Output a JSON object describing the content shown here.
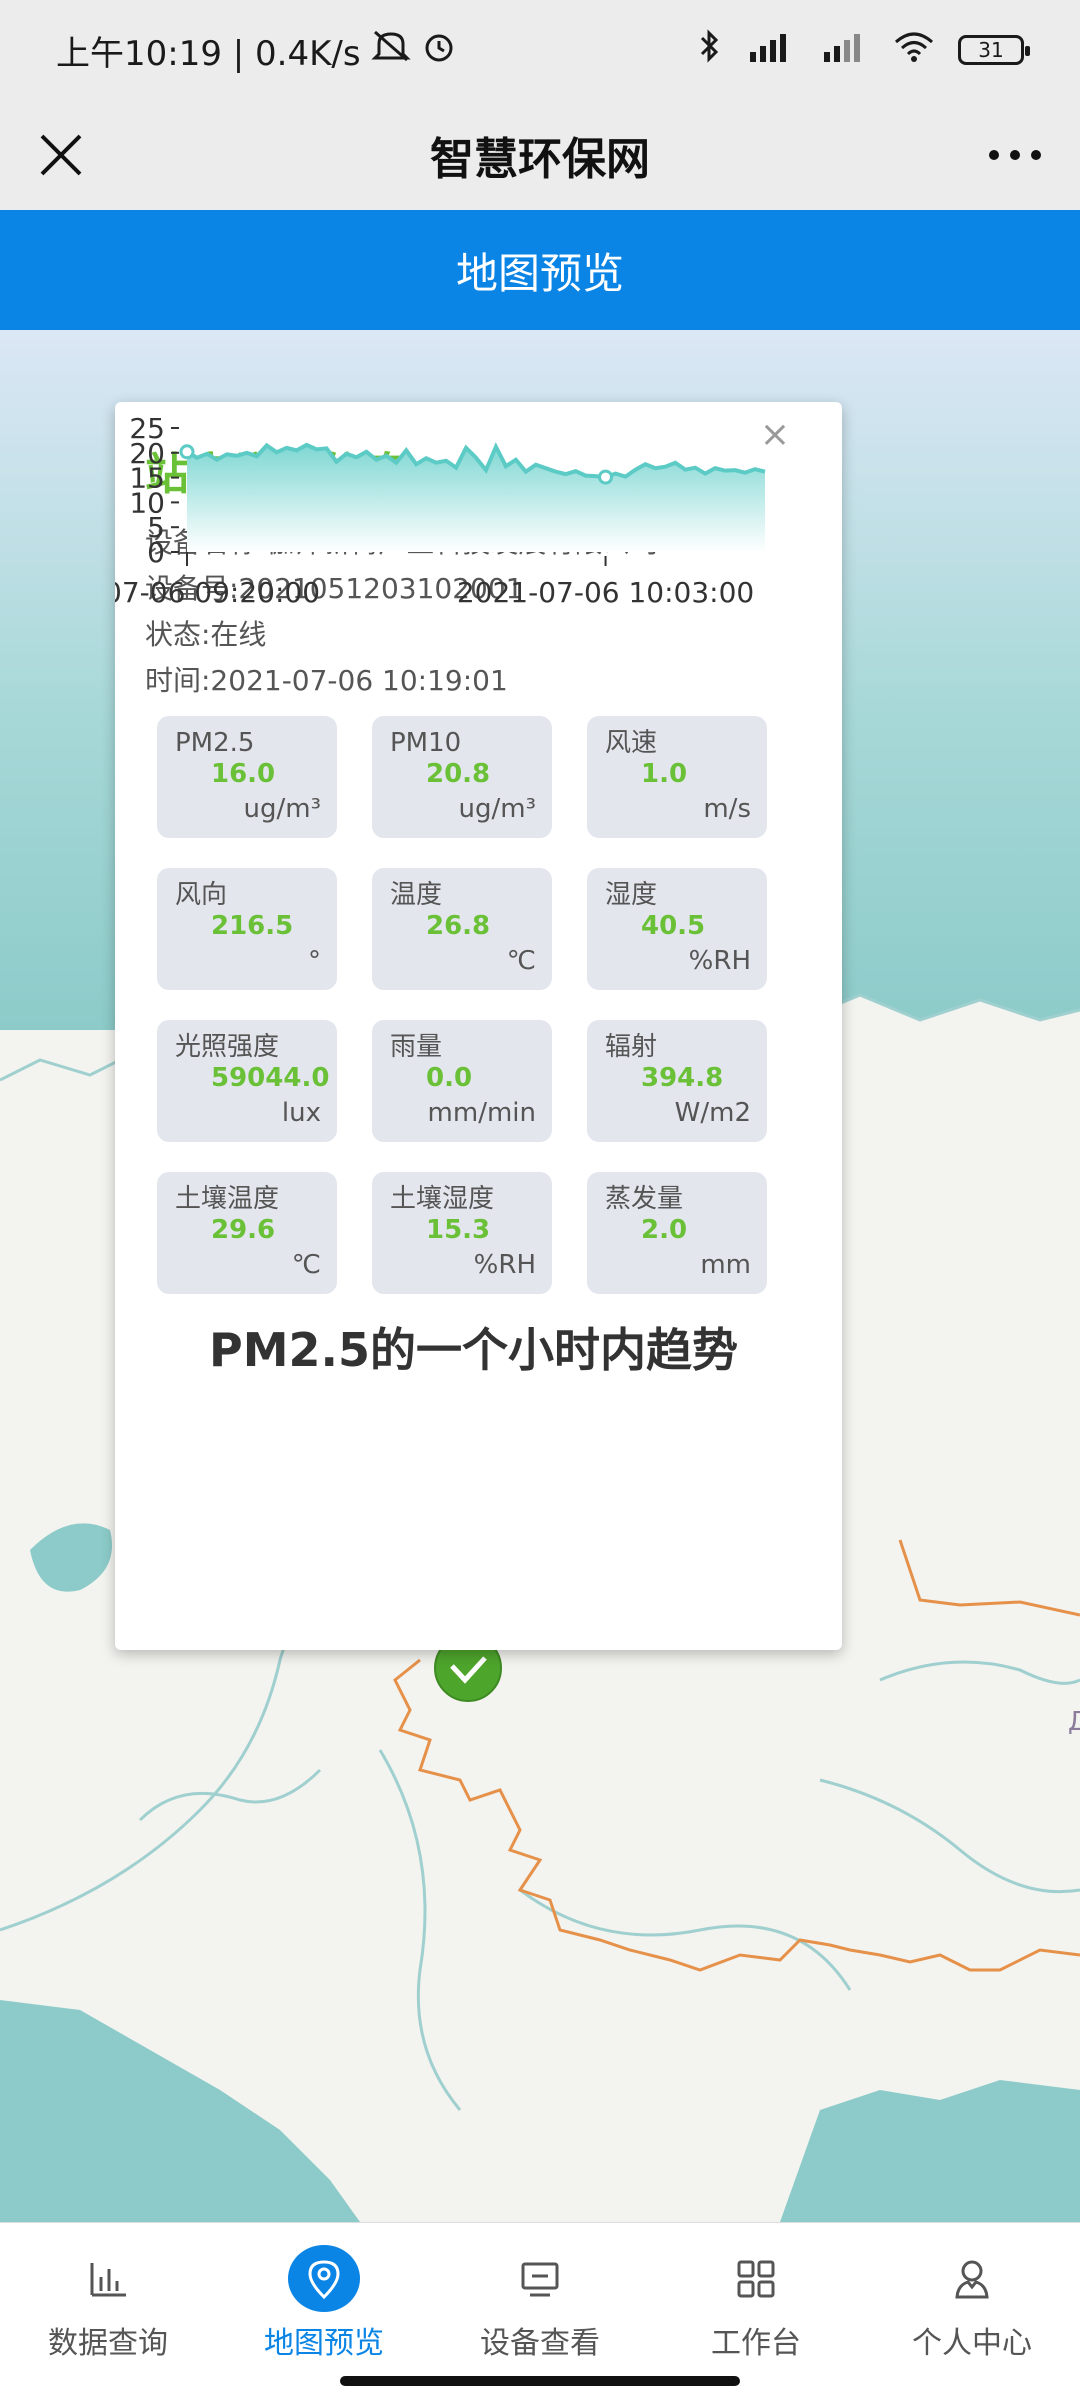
{
  "status_bar": {
    "time": "上午10:19 | 0.4K/s",
    "battery": "31"
  },
  "title_bar": {
    "title": "智慧环保网"
  },
  "header": {
    "title": "地图预览"
  },
  "popup": {
    "heading": "站点详细信息",
    "close_symbol": "×",
    "device_name": "设备名称:伽师新梅产业科技发展有限公司",
    "device_no": "设备号:2021051203102001",
    "status": "状态:在线",
    "time": "时间:2021-07-06 10:19:01",
    "metrics": [
      {
        "label": "PM2.5",
        "value": "16.0",
        "unit": "ug/m³"
      },
      {
        "label": "PM10",
        "value": "20.8",
        "unit": "ug/m³"
      },
      {
        "label": "风速",
        "value": "1.0",
        "unit": "m/s"
      },
      {
        "label": "风向",
        "value": "216.5",
        "unit": "°"
      },
      {
        "label": "温度",
        "value": "26.8",
        "unit": "℃"
      },
      {
        "label": "湿度",
        "value": "40.5",
        "unit": "%RH"
      },
      {
        "label": "光照强度",
        "value": "59044.0",
        "unit": "lux"
      },
      {
        "label": "雨量",
        "value": "0.0",
        "unit": "mm/min"
      },
      {
        "label": "辐射",
        "value": "394.8",
        "unit": "W/m2"
      },
      {
        "label": "土壤温度",
        "value": "29.6",
        "unit": "℃"
      },
      {
        "label": "土壤湿度",
        "value": "15.3",
        "unit": "%RH"
      },
      {
        "label": "蒸发量",
        "value": "2.0",
        "unit": "mm"
      }
    ],
    "chart_title": "PM2.5的一个小时内趋势"
  },
  "chart_data": {
    "type": "area",
    "title": "PM2.5的一个小时内趋势",
    "ylim": [
      0,
      25
    ],
    "yticks": [
      "0",
      "5",
      "10",
      "15",
      "20",
      "25"
    ],
    "xtick_labels": [
      "-07-06 09:20:00",
      "2021-07-06 10:03:00"
    ],
    "series": [
      {
        "values": [
          20.2,
          19.0,
          19.8,
          18.6,
          19.7,
          19.4,
          20.0,
          19.3,
          21.5,
          20.1,
          21.0,
          20.5,
          21.6,
          20.7,
          20.9,
          18.2,
          19.8,
          19.1,
          20.2,
          18.6,
          19.4,
          18.0,
          20.5,
          17.7,
          18.9,
          18.0,
          18.4,
          17.0,
          21.0,
          19.0,
          16.5,
          21.2,
          17.3,
          18.6,
          16.2,
          17.6,
          16.9,
          16.2,
          15.7,
          16.3,
          15.4,
          15.3,
          15.1,
          15.8,
          15.2,
          16.6,
          17.7,
          16.9,
          17.2,
          18.0,
          16.6,
          17.0,
          15.8,
          16.9,
          16.4,
          16.5,
          16.0,
          16.7,
          16.2
        ]
      }
    ],
    "colors": {
      "line": "#5ccbc6",
      "fill_top": "#7fd7d3",
      "fill_bottom": "#ffffff"
    },
    "grid": false
  },
  "nav": {
    "items": [
      {
        "label": "数据查询"
      },
      {
        "label": "地图预览"
      },
      {
        "label": "设备查看"
      },
      {
        "label": "工作台"
      },
      {
        "label": "个人中心"
      }
    ]
  },
  "colors": {
    "accent": "#0a85e6",
    "green": "#6ac137"
  }
}
